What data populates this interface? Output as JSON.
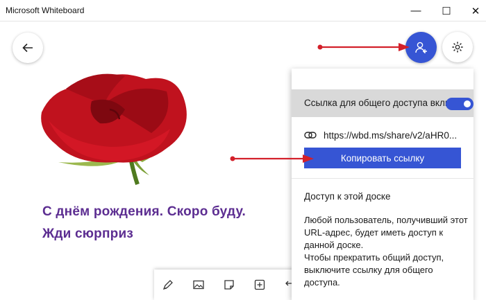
{
  "window": {
    "title": "Microsoft Whiteboard",
    "minimize_glyph": "—",
    "maximize_glyph": "☐",
    "close_glyph": "✕"
  },
  "board": {
    "greeting_line1": "С днём рождения. Скоро буду.",
    "greeting_line2": "Жди сюрприз",
    "greeting_color": "#5c2d91",
    "image_subject": "red-rose"
  },
  "toolbar": {
    "icons": [
      "pen-icon",
      "image-icon",
      "note-icon",
      "add-icon",
      "undo-icon"
    ]
  },
  "top_buttons": {
    "back_icon": "arrow-left-icon",
    "share_icon": "person-add-icon",
    "settings_icon": "gear-icon"
  },
  "share_panel": {
    "toggle_label": "Ссылка для общего доступа включена",
    "toggle_on": true,
    "url": "https://wbd.ms/share/v2/aHR0...",
    "copy_button": "Копировать ссылку",
    "access_title": "Доступ к этой доске",
    "access_desc_1": "Любой пользователь, получивший этот URL-адрес, будет иметь доступ к данной доске.",
    "access_desc_2": "Чтобы прекратить общий доступ, выключите ссылку для общего доступа."
  },
  "colors": {
    "accent": "#3655d4",
    "annotation_arrow": "#d3202a"
  }
}
